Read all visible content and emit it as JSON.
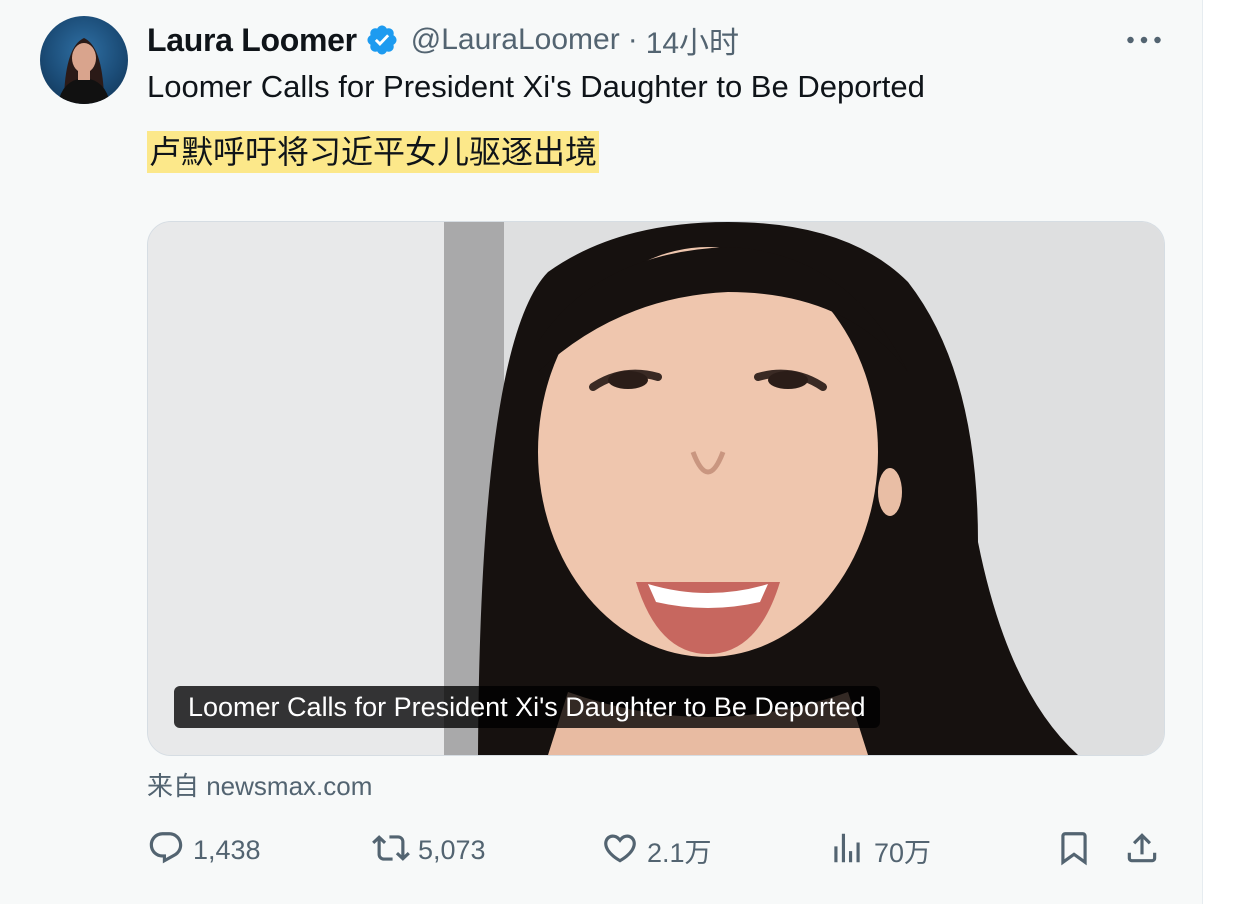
{
  "tweet": {
    "author": {
      "name": "Laura Loomer",
      "handle": "@LauraLoomer",
      "verified": true
    },
    "separator": "·",
    "time": "14小时",
    "text": "Loomer Calls for President Xi's Daughter to Be Deported",
    "translation": "卢默呼吁将习近平女儿驱逐出境",
    "card": {
      "title": "Loomer Calls for President Xi's Daughter to Be Deported"
    },
    "source": "来自 newsmax.com",
    "metrics": {
      "replies": "1,438",
      "reposts": "5,073",
      "likes": "2.1万",
      "views": "70万"
    }
  },
  "colors": {
    "verified": "#1d9bf0",
    "highlight": "#fce88a",
    "muted": "#536471",
    "background": "#f7f9f9"
  },
  "icons": [
    "more-icon",
    "verified-badge-icon",
    "reply-icon",
    "repost-icon",
    "like-icon",
    "views-icon",
    "bookmark-icon",
    "share-icon"
  ]
}
